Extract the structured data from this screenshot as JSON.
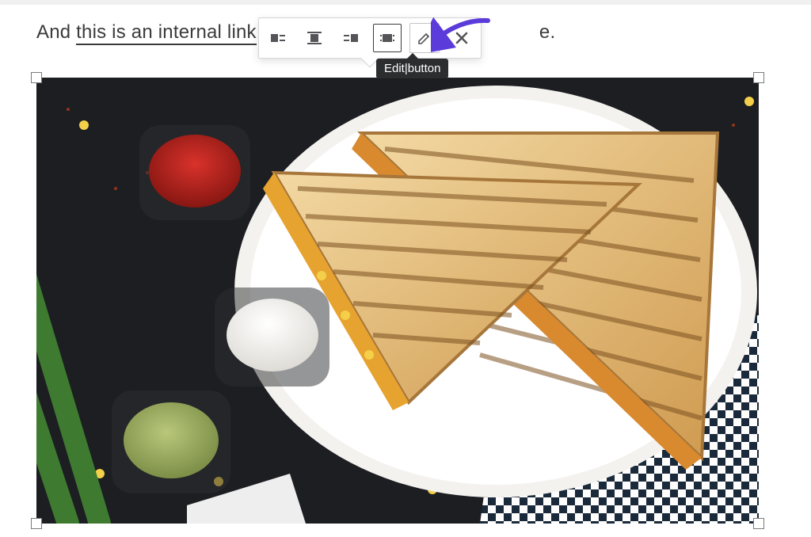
{
  "paragraph": {
    "before": "And ",
    "link_text": "this is an internal link",
    "after_visible_end": "e."
  },
  "toolbar": {
    "buttons": {
      "align_left": "Align left",
      "align_center": "Align center",
      "align_right": "Align right",
      "align_none": "No alignment",
      "edit": "Edit",
      "remove": "Remove"
    },
    "active_button": "align_none"
  },
  "tooltip": {
    "text": "Edit|button"
  },
  "image": {
    "alt": "Grilled sandwich on a white plate with corn, three dipping sauces (red, white, green), green onions and a checkered napkin",
    "selected": true
  },
  "annotation": {
    "arrow_color": "#5b3bd9"
  }
}
